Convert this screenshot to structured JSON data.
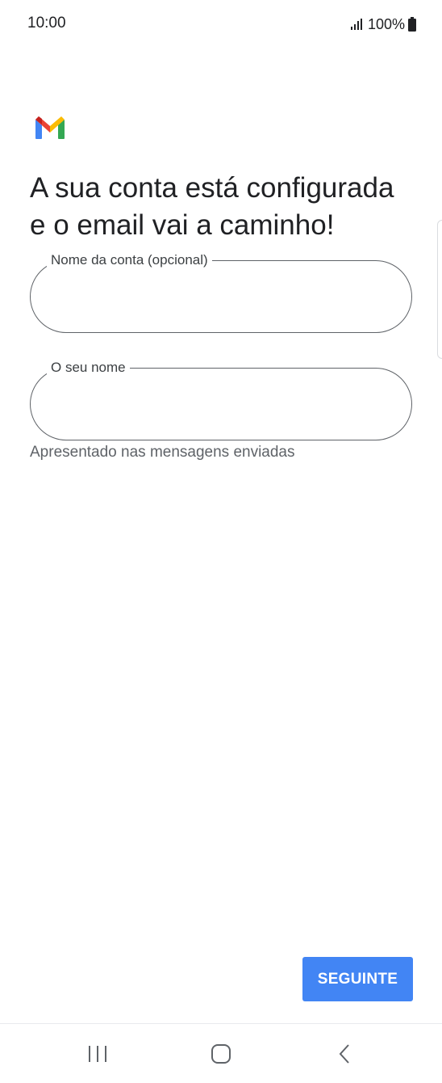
{
  "status_bar": {
    "time": "10:00",
    "battery": "100%",
    "icons": [
      "signal-icon",
      "battery-icon"
    ]
  },
  "app": {
    "logo": "gmail-logo-icon",
    "brand_colors": {
      "red": "#EA4335",
      "blue": "#4285F4",
      "green": "#34A853",
      "yellow": "#FBBC04",
      "dark_red": "#C5221F"
    }
  },
  "headline": "A sua conta está configurada e o email vai a caminho!",
  "form": {
    "account_name": {
      "label": "Nome da conta (opcional)",
      "value": ""
    },
    "your_name": {
      "label": "O seu nome",
      "value": "",
      "helper": "Apresentado nas mensagens enviadas"
    }
  },
  "actions": {
    "next_label": "SEGUINTE",
    "accent_color": "#4285F4"
  },
  "nav_bar": {
    "icons": [
      "recents-icon",
      "home-icon",
      "back-icon"
    ]
  }
}
